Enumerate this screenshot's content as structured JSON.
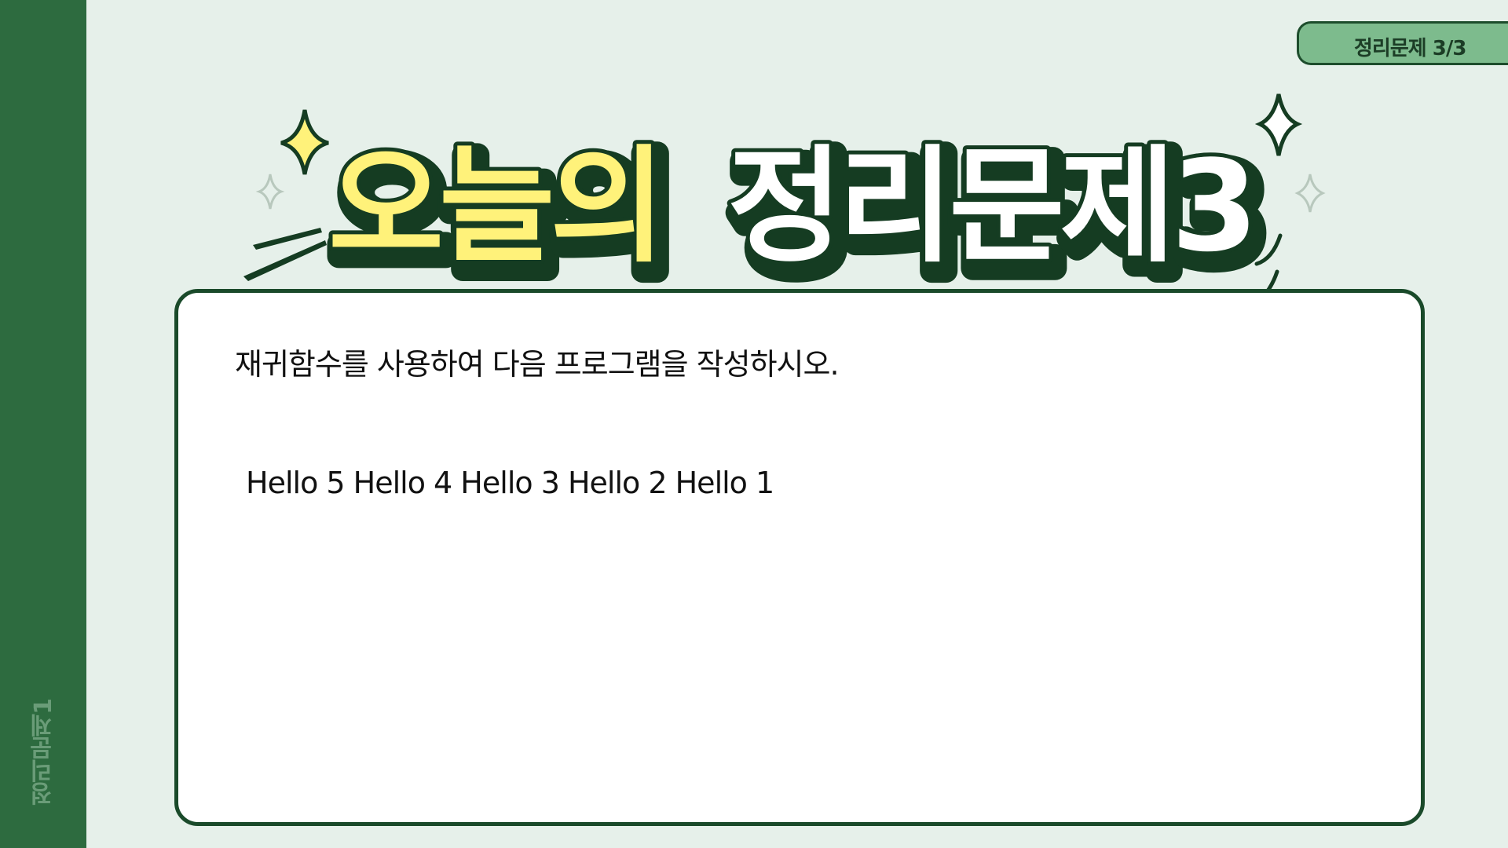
{
  "sidebar": {
    "label": "정리문제1"
  },
  "badge": {
    "label": "정리문제 3/3"
  },
  "title": {
    "part1": "오늘의",
    "part2": "정리문제3"
  },
  "card": {
    "question": "재귀함수를 사용하여 다음 프로그램을 작성하시오.",
    "output": "Hello 5 Hello 4 Hello 3 Hello 2 Hello 1"
  },
  "colors": {
    "background": "#e6f0ea",
    "sidebar": "#2d6b3f",
    "badge": "#7dbb8d",
    "title_yellow": "#fff27a",
    "title_outline": "#153c22"
  },
  "decorations": [
    "sparkle-icon",
    "speed-lines-icon"
  ]
}
